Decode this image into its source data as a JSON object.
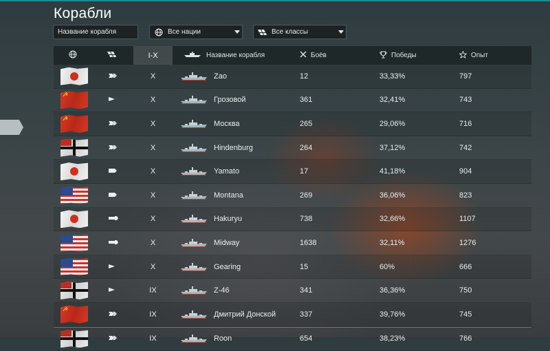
{
  "page": {
    "title": "Корабли"
  },
  "filters": {
    "search_placeholder": "Название корабля",
    "nation_label": "Все нации",
    "class_label": "Все классы"
  },
  "table": {
    "headers": {
      "tier": "I-X",
      "name": "Название корабля",
      "battles": "Боёв",
      "wins": "Победы",
      "exp": "Опыт"
    },
    "rows": [
      {
        "nation": "japan",
        "type": "cruiser",
        "tier": "X",
        "name": "Zao",
        "battles": "12",
        "wins": "33,33%",
        "exp": "797"
      },
      {
        "nation": "ussr",
        "type": "destroyer",
        "tier": "X",
        "name": "Грозовой",
        "battles": "361",
        "wins": "32,41%",
        "exp": "743"
      },
      {
        "nation": "ussr",
        "type": "cruiser",
        "tier": "X",
        "name": "Москва",
        "battles": "265",
        "wins": "29,06%",
        "exp": "716"
      },
      {
        "nation": "germany",
        "type": "cruiser",
        "tier": "X",
        "name": "Hindenburg",
        "battles": "264",
        "wins": "37,12%",
        "exp": "742"
      },
      {
        "nation": "japan",
        "type": "battleship",
        "tier": "X",
        "name": "Yamato",
        "battles": "17",
        "wins": "41,18%",
        "exp": "904"
      },
      {
        "nation": "usa",
        "type": "battleship",
        "tier": "X",
        "name": "Montana",
        "battles": "269",
        "wins": "36,06%",
        "exp": "823"
      },
      {
        "nation": "japan",
        "type": "carrier",
        "tier": "X",
        "name": "Hakuryu",
        "battles": "738",
        "wins": "32,66%",
        "exp": "1107"
      },
      {
        "nation": "usa",
        "type": "carrier",
        "tier": "X",
        "name": "Midway",
        "battles": "1638",
        "wins": "32,11%",
        "exp": "1276"
      },
      {
        "nation": "usa",
        "type": "destroyer",
        "tier": "X",
        "name": "Gearing",
        "battles": "15",
        "wins": "60%",
        "exp": "666"
      },
      {
        "nation": "germany",
        "type": "destroyer",
        "tier": "IX",
        "name": "Z-46",
        "battles": "341",
        "wins": "36,36%",
        "exp": "750"
      },
      {
        "nation": "ussr",
        "type": "cruiser",
        "tier": "IX",
        "name": "Дмитрий Донской",
        "battles": "337",
        "wins": "39,76%",
        "exp": "745"
      },
      {
        "nation": "germany",
        "type": "cruiser",
        "tier": "IX",
        "name": "Roon",
        "battles": "654",
        "wins": "38,23%",
        "exp": "766"
      }
    ]
  },
  "colors": {
    "accent": "#1e8c96",
    "header_bg": "#1c2426",
    "text": "#e9eef0"
  }
}
